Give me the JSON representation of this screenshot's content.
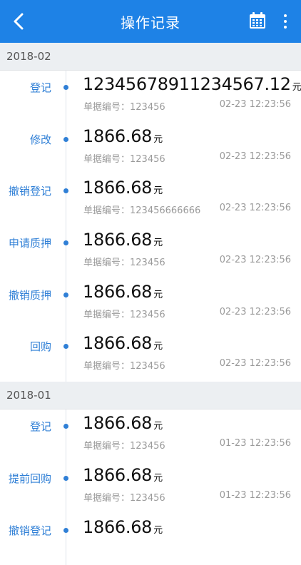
{
  "header": {
    "title": "操作记录",
    "icons": [
      "back-icon",
      "calendar-icon",
      "more-icon"
    ]
  },
  "groups": [
    {
      "month": "2018-02",
      "records": [
        {
          "action": "登记",
          "amount": "12345678911234567.12",
          "unit": "元",
          "doc": "单据编号：123456",
          "time": "02-23  12:23:56"
        },
        {
          "action": "修改",
          "amount": "1866.68",
          "unit": "元",
          "doc": "单据编号：123456",
          "time": "02-23  12:23:56"
        },
        {
          "action": "撤销登记",
          "amount": "1866.68",
          "unit": "元",
          "doc": "单据编号：123456666666",
          "time": "02-23  12:23:56"
        },
        {
          "action": "申请质押",
          "amount": "1866.68",
          "unit": "元",
          "doc": "单据编号：123456",
          "time": "02-23  12:23:56"
        },
        {
          "action": "撤销质押",
          "amount": "1866.68",
          "unit": "元",
          "doc": "单据编号：123456",
          "time": "02-23  12:23:56"
        },
        {
          "action": "回购",
          "amount": "1866.68",
          "unit": "元",
          "doc": "单据编号：123456",
          "time": "02-23  12:23:56"
        }
      ]
    },
    {
      "month": "2018-01",
      "records": [
        {
          "action": "登记",
          "amount": "1866.68",
          "unit": "元",
          "doc": "单据编号：123456",
          "time": "01-23  12:23:56"
        },
        {
          "action": "提前回购",
          "amount": "1866.68",
          "unit": "元",
          "doc": "单据编号：123456",
          "time": "01-23  12:23:56"
        },
        {
          "action": "撤销登记",
          "amount": "1866.68",
          "unit": "元",
          "doc": "",
          "time": ""
        }
      ]
    }
  ],
  "colors": {
    "primary": "#1e82e6",
    "accent": "#2f7fd6",
    "month_bg": "#eceff2"
  }
}
